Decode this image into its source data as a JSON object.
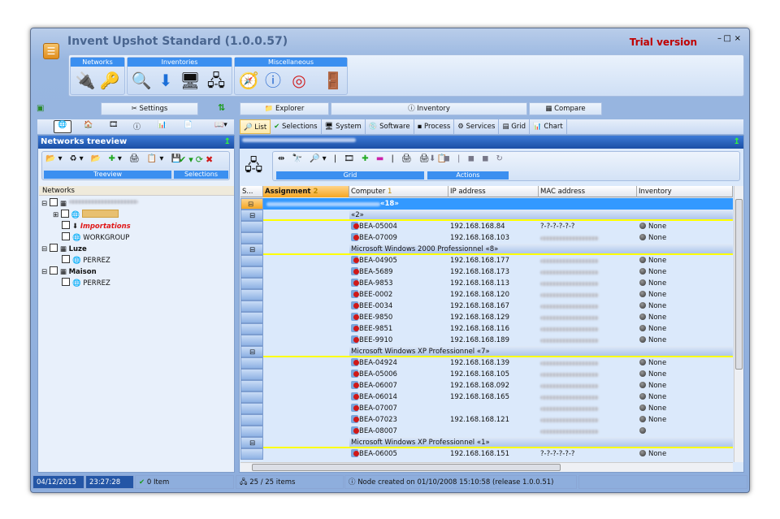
{
  "window": {
    "title": "Invent Upshot Standard (1.0.0.57)",
    "trial": "Trial version",
    "controls": {
      "minimize": "–",
      "maximize": "□",
      "close": "×"
    }
  },
  "ribbon": {
    "groups": [
      {
        "label": "Networks",
        "icons": [
          "network-check-icon",
          "keys-icon"
        ]
      },
      {
        "label": "Inventories",
        "icons": [
          "computer-search-icon",
          "download-icon",
          "computer-info-icon",
          "computers-icon"
        ]
      },
      {
        "label": "Miscellaneous",
        "icons": [
          "map-compass-icon",
          "info-icon",
          "lifebuoy-icon",
          "exit-door-icon"
        ]
      }
    ]
  },
  "left_tabs": {
    "settings": "Settings"
  },
  "right_tabs": {
    "top": [
      "Explorer",
      "Inventory",
      "Compare"
    ],
    "sub": [
      "List",
      "Selections",
      "System",
      "Software",
      "Process",
      "Services",
      "Grid",
      "Chart"
    ],
    "selected": "List"
  },
  "treeview": {
    "title": "Networks treeview",
    "groups": [
      "Treeview",
      "Selections"
    ],
    "column": "Networks",
    "nodes": [
      {
        "label": "",
        "level": 0,
        "bold": false
      },
      {
        "label": "",
        "level": 1
      },
      {
        "label": "Importations",
        "level": 1,
        "style": "red-italic"
      },
      {
        "label": "WORKGROUP",
        "level": 1
      },
      {
        "label": "Luze",
        "level": 0,
        "bold": true
      },
      {
        "label": "PERREZ",
        "level": 1
      },
      {
        "label": "Maison",
        "level": 0,
        "bold": true
      },
      {
        "label": "PERREZ",
        "level": 1
      }
    ]
  },
  "grid": {
    "groups": [
      "Grid",
      "Actions"
    ],
    "columns": [
      "S...",
      "Assignment",
      "Computer",
      "IP address",
      "MAC address",
      "Inventory"
    ],
    "sort_badges": {
      "assignment": "2",
      "computer": "1"
    },
    "rows": [
      {
        "type": "group",
        "label": "«18»",
        "top": true
      },
      {
        "type": "group",
        "label": "«2»"
      },
      {
        "computer": "BEA-05004",
        "ip": "192.168.168.84",
        "mac": "?-?-?-?-?-?",
        "inv": "None"
      },
      {
        "computer": "BEA-07009",
        "ip": "192.168.168.103",
        "mac": "",
        "inv": "None"
      },
      {
        "type": "group",
        "label": "Microsoft Windows 2000 Professionnel «8»"
      },
      {
        "computer": "BEA-04905",
        "ip": "192.168.168.177",
        "mac": "",
        "inv": "None"
      },
      {
        "computer": "BEA-5689",
        "ip": "192.168.168.173",
        "mac": "",
        "inv": "None"
      },
      {
        "computer": "BEA-9853",
        "ip": "192.168.168.113",
        "mac": "",
        "inv": "None"
      },
      {
        "computer": "BEE-0002",
        "ip": "192.168.168.120",
        "mac": "",
        "inv": "None"
      },
      {
        "computer": "BEE-0034",
        "ip": "192.168.168.167",
        "mac": "",
        "inv": "None"
      },
      {
        "computer": "BEE-9850",
        "ip": "192.168.168.129",
        "mac": "",
        "inv": "None"
      },
      {
        "computer": "BEE-9851",
        "ip": "192.168.168.116",
        "mac": "",
        "inv": "None"
      },
      {
        "computer": "BEE-9910",
        "ip": "192.168.168.189",
        "mac": "",
        "inv": "None"
      },
      {
        "type": "group",
        "label": "Microsoft Windows XP Professionnel «7»"
      },
      {
        "computer": "BEA-04924",
        "ip": "192.168.168.139",
        "mac": "",
        "inv": "None"
      },
      {
        "computer": "BEA-05006",
        "ip": "192.168.168.105",
        "mac": "",
        "inv": "None"
      },
      {
        "computer": "BEA-06007",
        "ip": "192.168.168.092",
        "mac": "",
        "inv": "None"
      },
      {
        "computer": "BEA-06014",
        "ip": "192.168.168.165",
        "mac": "",
        "inv": "None"
      },
      {
        "computer": "BEA-07007",
        "ip": "",
        "mac": "",
        "inv": "None"
      },
      {
        "computer": "BEA-07023",
        "ip": "192.168.168.121",
        "mac": "",
        "inv": "None"
      },
      {
        "computer": "BEA-08007",
        "ip": "",
        "mac": "",
        "inv": ""
      },
      {
        "type": "group",
        "label": "Microsoft Windows XP Professionnel   «1»"
      },
      {
        "computer": "BEA-06005",
        "ip": "192.168.168.151",
        "mac": "?-?-?-?-?-?",
        "inv": "None"
      }
    ]
  },
  "statusbar": {
    "date": "04/12/2015",
    "time": "23:27:28",
    "selected": "0 Item",
    "items": "25 / 25 items",
    "node_info": "Node created on 01/10/2008 15:10:58 (release 1.0.0.51)"
  },
  "colors": {
    "accent": "#3b8ff0",
    "selected_row": "#3399ff",
    "group_line": "#ffff00",
    "trial": "#c00000"
  }
}
